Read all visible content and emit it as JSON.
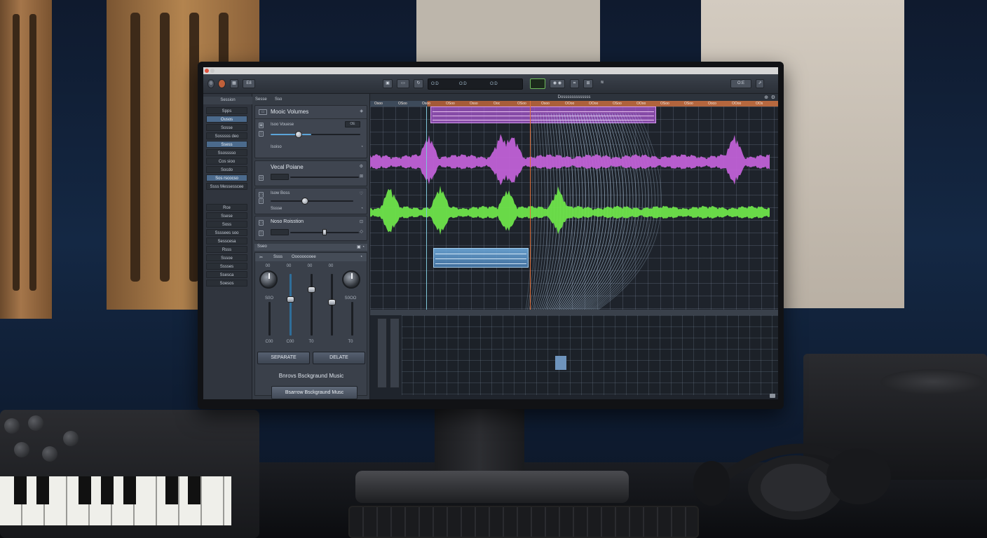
{
  "toolbar": {
    "button_1": "E8",
    "transport": [
      "O:D",
      "O:D",
      "O:D"
    ],
    "right_button": "O:E"
  },
  "left_nav": {
    "header": "Session",
    "items": [
      {
        "label": "Spps",
        "selected": false
      },
      {
        "label": "Ousos",
        "selected": true
      },
      {
        "label": "Sosse",
        "selected": false
      },
      {
        "label": "Sosssss deo",
        "selected": false
      },
      {
        "label": "Ssess",
        "selected": true
      },
      {
        "label": "Ssosssso",
        "selected": false
      },
      {
        "label": "Cos sioo",
        "selected": false
      },
      {
        "label": "Socdo",
        "selected": false
      },
      {
        "label": "Sos rscocso",
        "selected": true
      },
      {
        "label": "Ssss Messesscee",
        "selected": false
      },
      {
        "label": "Rce",
        "selected": false
      },
      {
        "label": "Ssese",
        "selected": false
      },
      {
        "label": "Soss",
        "selected": false
      },
      {
        "label": "Ssssees soo",
        "selected": false
      },
      {
        "label": "Sesscesa",
        "selected": false
      },
      {
        "label": "Rsss",
        "selected": false
      },
      {
        "label": "Sssoe",
        "selected": false
      },
      {
        "label": "Sssses",
        "selected": false
      },
      {
        "label": "Ssesca",
        "selected": false
      },
      {
        "label": "Soesos",
        "selected": false
      }
    ]
  },
  "mid_panel": {
    "tabs": [
      "Sesse",
      "Sso"
    ],
    "music_volume": {
      "title": "Mooic Volumes",
      "sub_label": "Isoo Vouese",
      "value_box": "OE",
      "footer": "Isoiso",
      "level": 0.45
    },
    "vocal_volume": {
      "title": "Vecal Poiane",
      "level": 0.12
    },
    "third_card": {
      "sub_label": "Isow Boss",
      "footer": "Sssse",
      "level": 0.45
    },
    "noise_reduction": {
      "title": "Noso Roisstion",
      "level": 0.55
    },
    "mixer": {
      "header_tabs": [
        "Ssss",
        "Ooooooooee"
      ],
      "top_labels": [
        "00",
        "00",
        "00",
        "00"
      ],
      "mid_labels": [
        "S0O",
        "S0OO"
      ],
      "bottom_labels": [
        "C00",
        "C00",
        "T0",
        "T0"
      ],
      "fader_levels": [
        0.6,
        0.3,
        0.35,
        0.55
      ],
      "separate_label": "SEPARATE",
      "delete_label": "DELATE",
      "bg_music_label": "Bnrovs Bsckgraund Music",
      "bg_music_button": "Bsarrow Bsckgraund Musc"
    }
  },
  "timeline": {
    "title": "Dosssssssssssss",
    "ruler_labels": [
      "Osoo",
      "OSoo",
      "Osoo",
      "OSoo",
      "Osso",
      "Ooc",
      "OSoo",
      "Osoo",
      "OOoo",
      "OOoo",
      "OSoo",
      "OOoo",
      "OSoo",
      "OSoo",
      "Ooco",
      "OOoo",
      "OOs"
    ],
    "vocal_color": "#c061d6",
    "music_color": "#6ee44a",
    "playhead_color": "#e0703a"
  }
}
